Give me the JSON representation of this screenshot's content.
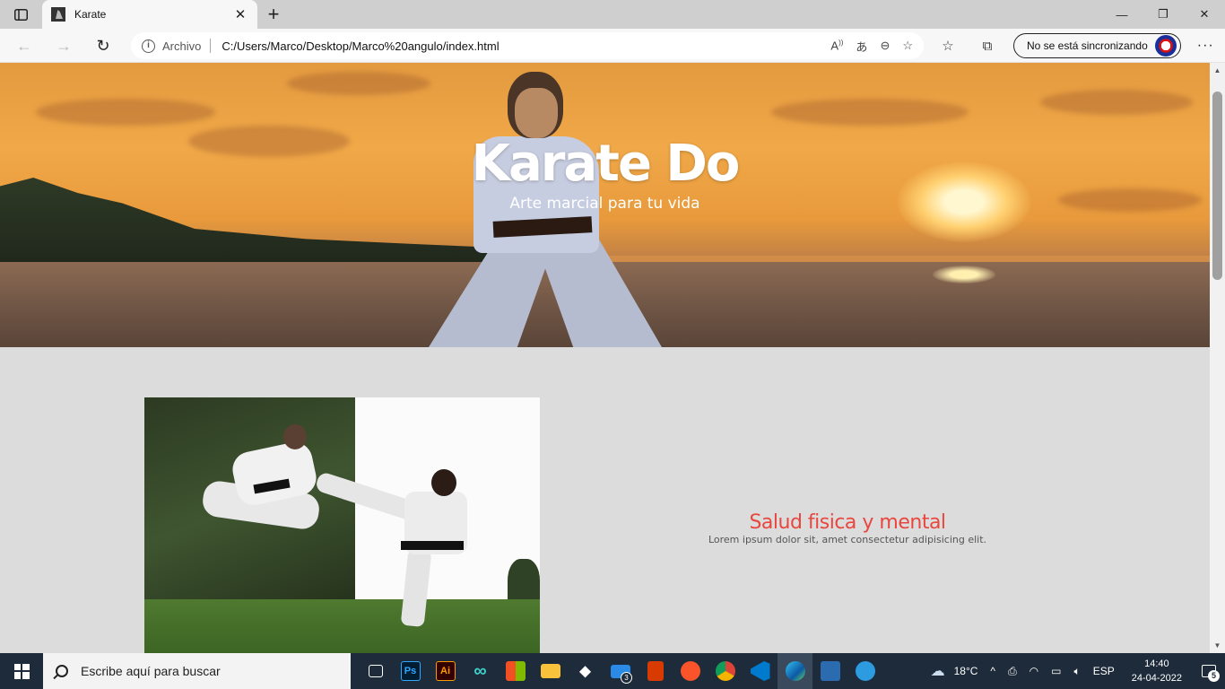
{
  "browser": {
    "tab_title": "Karate",
    "address_label": "Archivo",
    "url": "C:/Users/Marco/Desktop/Marco%20angulo/index.html",
    "sync_label": "No se está sincronizando"
  },
  "hero": {
    "title": "Karate Do",
    "subtitle": "Arte marcial para tu vida"
  },
  "feature": {
    "title": "Salud fisica y mental",
    "text": "Lorem ipsum dolor sit, amet consectetur adipisicing elit."
  },
  "taskbar": {
    "search_placeholder": "Escribe aquí para buscar",
    "weather_temp": "18°C",
    "language": "ESP",
    "time": "14:40",
    "date": "24-04-2022",
    "mail_badge": "3",
    "notification_count": "5"
  },
  "colors": {
    "feature_title": "#e8473f",
    "page_background": "#dcdcdc",
    "taskbar": "#1d2b3a"
  }
}
